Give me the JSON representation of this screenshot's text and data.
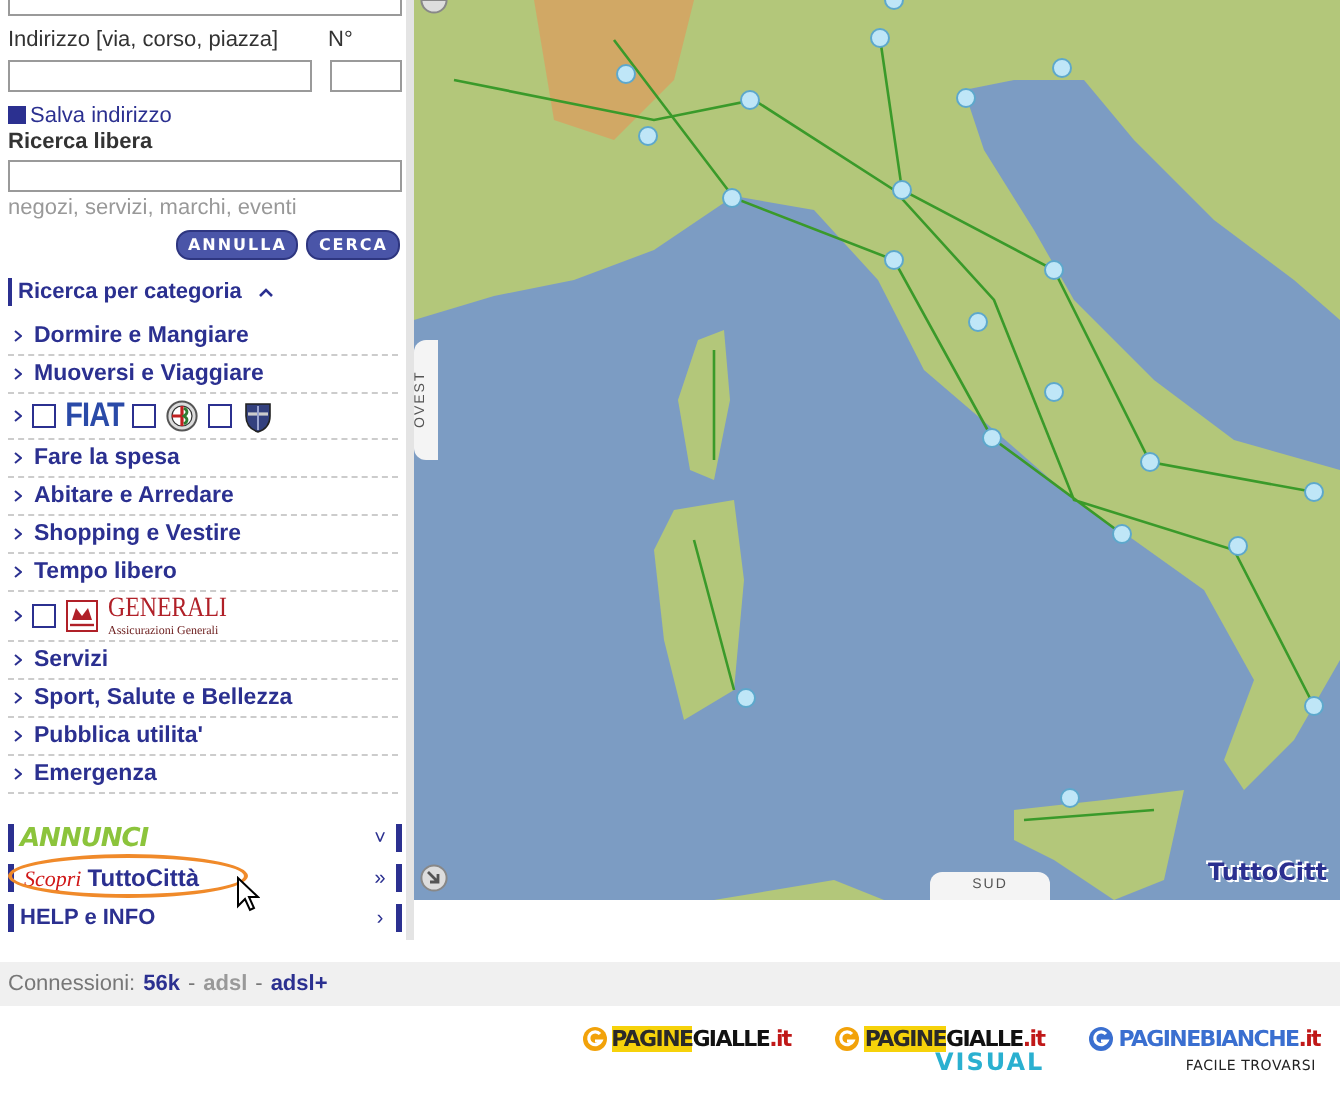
{
  "search": {
    "address_label": "Indirizzo [via, corso, piazza]",
    "number_label": "N°",
    "save": {
      "label": "Salva indirizzo",
      "checked": true
    },
    "free_label": "Ricerca libera",
    "free_hint": "negozi, servizi, marchi, eventi",
    "buttons": [
      "ANNULLA",
      "CERCA"
    ]
  },
  "categories": {
    "title": "Ricerca per categoria",
    "expanded": true,
    "items": [
      {
        "kind": "link",
        "label": "Dormire e Mangiare"
      },
      {
        "kind": "link",
        "label": "Muoversi e Viaggiare"
      },
      {
        "kind": "brands",
        "brands": [
          {
            "kind": "wordmark",
            "label": "FIAT",
            "checked": false
          },
          {
            "kind": "alfa",
            "checked": false
          },
          {
            "kind": "lancia",
            "checked": false
          }
        ]
      },
      {
        "kind": "link",
        "label": "Fare la spesa"
      },
      {
        "kind": "link",
        "label": "Abitare e Arredare"
      },
      {
        "kind": "link",
        "label": "Shopping e Vestire"
      },
      {
        "kind": "link",
        "label": "Tempo libero"
      },
      {
        "kind": "brands",
        "brands": [
          {
            "kind": "generali",
            "label": "GENERALI",
            "sub": "Assicurazioni Generali",
            "checked": false
          }
        ]
      },
      {
        "kind": "link",
        "label": "Servizi"
      },
      {
        "kind": "link",
        "label": "Sport, Salute e Bellezza"
      },
      {
        "kind": "link",
        "label": "Pubblica utilita'"
      },
      {
        "kind": "link",
        "label": "Emergenza"
      }
    ]
  },
  "panels": [
    {
      "kind": "annunci",
      "label": "ANNUNCI",
      "caret": "˅"
    },
    {
      "kind": "scopri",
      "label_1": "Scopri",
      "label_2": "TuttoCittà",
      "caret": "»",
      "highlighted": true
    },
    {
      "kind": "help",
      "label": "HELP e INFO",
      "caret": "›"
    }
  ],
  "map": {
    "west_label": "OVEST",
    "south_label": "SUD",
    "logo": "TuttoCitt"
  },
  "connections": {
    "label": "Connessioni:",
    "separator": "-",
    "options": [
      {
        "label": "56k",
        "selected": false
      },
      {
        "label": "adsl",
        "selected": true
      },
      {
        "label": "adsl+",
        "selected": false
      }
    ]
  },
  "footer_logos": [
    {
      "parts": [
        "PAGINE",
        "GIALLE",
        ".it"
      ]
    },
    {
      "parts": [
        "PAGINE",
        "GIALLE",
        ".it"
      ],
      "sub": "VISUAL"
    },
    {
      "parts": [
        "PAGINE",
        "BIANCHE",
        ".it"
      ],
      "sub": "FACILE TROVARSI"
    }
  ]
}
